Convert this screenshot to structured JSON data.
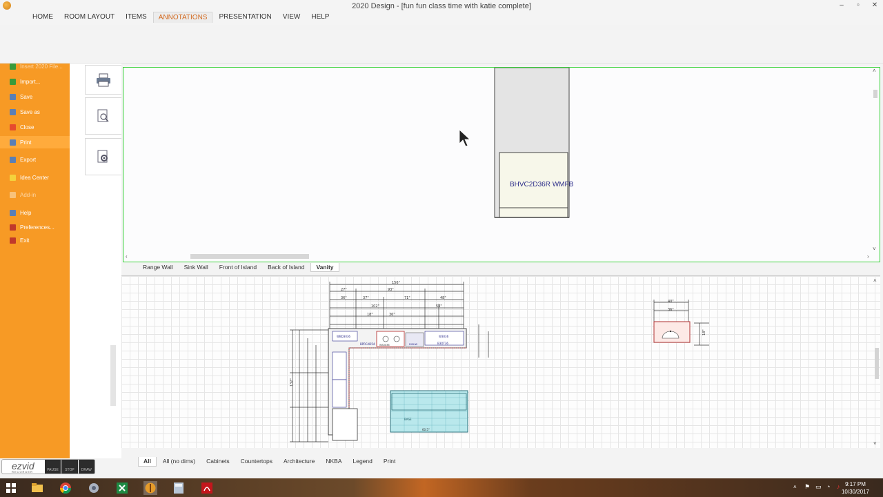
{
  "window": {
    "title": "2020 Design - [fun fun class time with katie complete]",
    "controls": [
      "–",
      "▫",
      "✕"
    ]
  },
  "ribbon": {
    "tabs": [
      "HOME",
      "ROOM LAYOUT",
      "ITEMS",
      "ANNOTATIONS",
      "PRESENTATION",
      "VIEW",
      "HELP"
    ],
    "active_tab": "ANNOTATIONS"
  },
  "file_menu": {
    "items": [
      {
        "label": "Insert 2020 File...",
        "icon": "insert-icon",
        "color": "#3a9a3a"
      },
      {
        "label": "Import...",
        "icon": "import-icon",
        "color": "#3a9a3a"
      },
      {
        "label": "Save",
        "icon": "save-icon",
        "color": "#5b7fb5"
      },
      {
        "label": "Save as",
        "icon": "save-as-icon",
        "color": "#5b7fb5"
      },
      {
        "label": "Close",
        "icon": "close-file-icon",
        "color": "#e64a2e"
      },
      {
        "label": "Print",
        "icon": "print-icon",
        "color": "#5b7fb5"
      },
      {
        "label": "Export",
        "icon": "export-icon",
        "color": "#5b7fb5"
      },
      {
        "label": "Idea Center",
        "icon": "idea-center-icon",
        "color": "#f4d23c"
      },
      {
        "label": "Add-in",
        "icon": "add-in-icon",
        "color": "#f8c27a"
      },
      {
        "label": "Help",
        "icon": "help-icon",
        "color": "#5b7fb5"
      },
      {
        "label": "Preferences...",
        "icon": "preferences-icon",
        "color": "#c0392b"
      },
      {
        "label": "Exit",
        "icon": "exit-icon",
        "color": "#c0392b"
      }
    ],
    "active": "Print"
  },
  "preview_buttons": [
    "print-icon",
    "print-preview-icon",
    "print-setup-icon"
  ],
  "elevation": {
    "cabinet_label": "BHVC2D36R WMFB"
  },
  "elevation_tabs": {
    "tabs": [
      "Range Wall",
      "Sink Wall",
      "Front of Island",
      "Back of Island",
      "Vanity"
    ],
    "active": "Vanity"
  },
  "plan": {
    "dimensions": [
      "156\"",
      "27\"",
      "93\"",
      "36\"",
      "37\"",
      "71\"",
      "48\"",
      "102\"",
      "54\"",
      "18\"",
      "36\"",
      "40\"",
      "36\"",
      "18\"",
      "132\""
    ],
    "labels": [
      "WBD3036",
      "WS3036",
      "BPRCAD54",
      "DISHW",
      "B3OT36",
      "W3036",
      "60.5\"",
      "BASE"
    ]
  },
  "plan_tabs": {
    "tabs": [
      "All",
      "All (no dims)",
      "Cabinets",
      "Countertops",
      "Architecture",
      "NKBA",
      "Legend",
      "Print"
    ],
    "active": "All"
  },
  "ezvid": {
    "logo": "ezvid",
    "sub": "RECORDER",
    "buttons": [
      "PAUSE",
      "STOP",
      "DRAW"
    ]
  },
  "taskbar": {
    "apps": [
      "windows-start-icon",
      "file-explorer-icon",
      "chrome-icon",
      "app-icon",
      "excel-icon",
      "2020-design-icon",
      "calculator-icon",
      "acrobat-icon"
    ],
    "time": "9:17 PM",
    "date": "10/30/2017"
  },
  "colors": {
    "menu_orange": "#f79a25",
    "active_tab": "#d2691e",
    "viewport_border": "#3ad23a"
  }
}
